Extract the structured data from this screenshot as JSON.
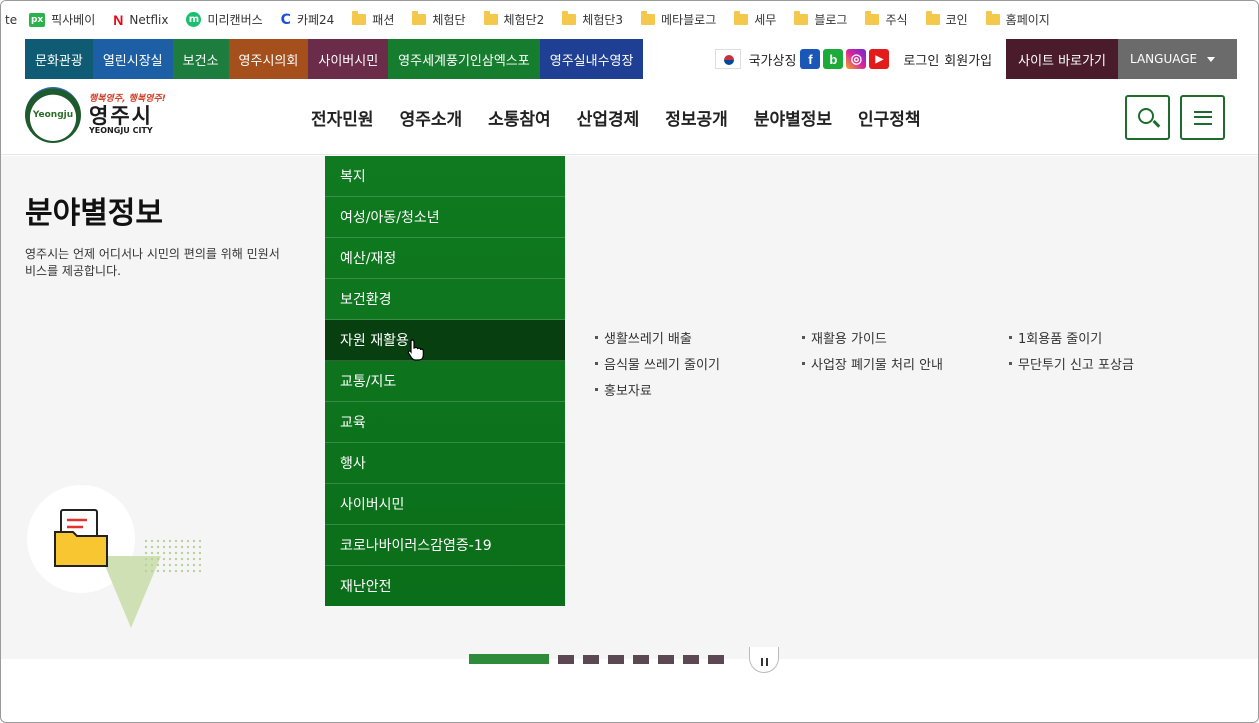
{
  "bookmarks": [
    {
      "label": "te",
      "icon": "generic"
    },
    {
      "label": "픽사베이",
      "icon": "pixabay-icon"
    },
    {
      "label": "Netflix",
      "icon": "netflix-icon"
    },
    {
      "label": "미리캔버스",
      "icon": "miricanvas-icon"
    },
    {
      "label": "카페24",
      "icon": "cafe24-icon"
    },
    {
      "label": "패션",
      "icon": "folder-icon"
    },
    {
      "label": "체험단",
      "icon": "folder-icon"
    },
    {
      "label": "체험단2",
      "icon": "folder-icon"
    },
    {
      "label": "체험단3",
      "icon": "folder-icon"
    },
    {
      "label": "메타블로그",
      "icon": "folder-icon"
    },
    {
      "label": "세무",
      "icon": "folder-icon"
    },
    {
      "label": "블로그",
      "icon": "folder-icon"
    },
    {
      "label": "주식",
      "icon": "folder-icon"
    },
    {
      "label": "코인",
      "icon": "folder-icon"
    },
    {
      "label": "홈페이지",
      "icon": "folder-icon"
    }
  ],
  "utility": {
    "tabs": [
      {
        "label": "문화관광",
        "color": "#0e5b73"
      },
      {
        "label": "열린시장실",
        "color": "#1c5fa4"
      },
      {
        "label": "보건소",
        "color": "#1c7d3f"
      },
      {
        "label": "영주시의회",
        "color": "#a5501c"
      },
      {
        "label": "사이버시민",
        "color": "#6b2c4a"
      },
      {
        "label": "영주세계풍기인삼엑스포",
        "color": "#177d2e"
      },
      {
        "label": "영주실내수영장",
        "color": "#1f3f94"
      }
    ],
    "national_symbol": "국가상징",
    "login": "로그인",
    "join": "회원가입",
    "sites_button": "사이트 바로가기",
    "language_button": "LANGUAGE"
  },
  "header": {
    "logo_slogan": "행복영주, 행복영주!",
    "logo_kor": "영주시",
    "logo_eng": "YEONGJU CITY",
    "logo_badge": "Yeongju",
    "nav": [
      "전자민원",
      "영주소개",
      "소통참여",
      "산업경제",
      "정보공개",
      "분야별정보",
      "인구정책"
    ]
  },
  "mega": {
    "title": "분야별정보",
    "description": "영주시는 언제 어디서나 시민의 편의를 위해 민원서비스를 제공합니다.",
    "submenu": [
      "복지",
      "여성/아동/청소년",
      "예산/재정",
      "보건환경",
      "자원 재활용",
      "교통/지도",
      "교육",
      "행사",
      "사이버시민",
      "코로나바이러스감염증-19",
      "재난안전"
    ],
    "active_submenu": "자원 재활용",
    "sub_links": [
      "생활쓰레기 배출",
      "재활용 가이드",
      "1회용품 줄이기",
      "음식물 쓰레기 줄이기",
      "사업장 폐기물 처리 안내",
      "무단투기 신고 포상금",
      "홍보자료"
    ]
  },
  "colors": {
    "accent_green": "#1e6b2e",
    "submenu_bg": "#0f7a20",
    "submenu_active": "#083f10"
  }
}
